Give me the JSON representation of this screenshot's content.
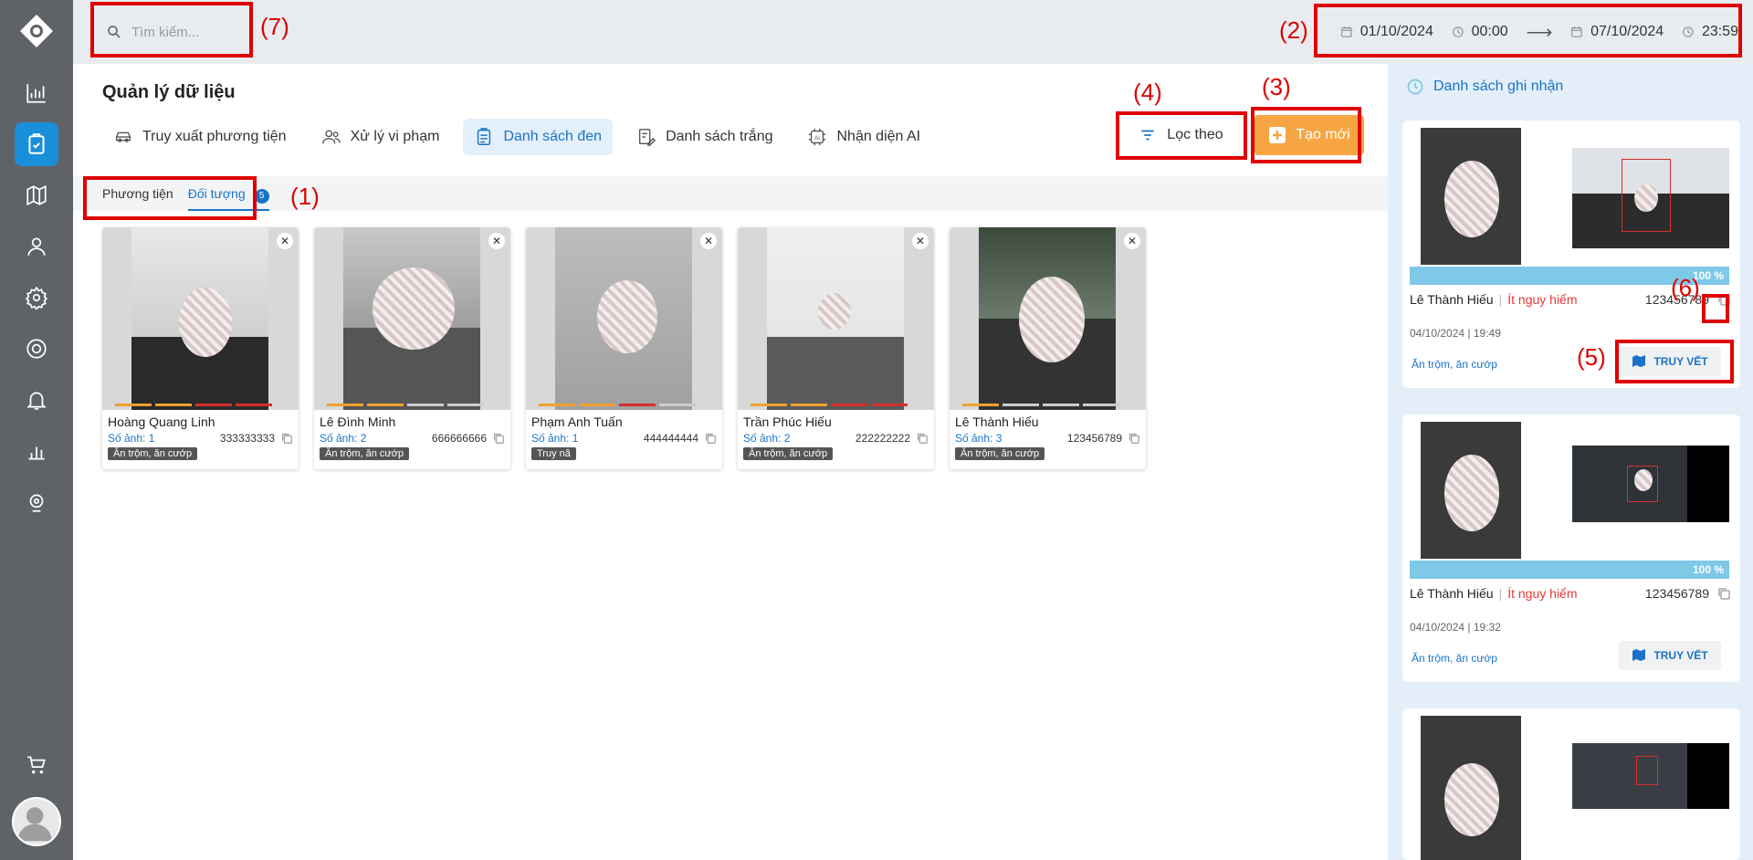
{
  "search": {
    "placeholder": "Tìm kiếm..."
  },
  "date_range": {
    "from_date": "01/10/2024",
    "from_time": "00:00",
    "to_date": "07/10/2024",
    "to_time": "23:59"
  },
  "page": {
    "title": "Quản lý dữ liệu"
  },
  "tabs": [
    {
      "label": "Truy xuất phương tiện",
      "icon": "car-icon"
    },
    {
      "label": "Xử lý vi phạm",
      "icon": "users-icon"
    },
    {
      "label": "Danh sách đen",
      "icon": "clipboard-icon",
      "active": true
    },
    {
      "label": "Danh sách trắng",
      "icon": "edit-list-icon"
    },
    {
      "label": "Nhận diện AI",
      "icon": "ai-chip-icon"
    }
  ],
  "actions": {
    "filter_label": "Lọc theo",
    "new_label": "Tạo mới"
  },
  "subtabs": {
    "vehicle": "Phương tiện",
    "subject": "Đối tượng",
    "subject_count": "5"
  },
  "annotations": [
    "(1)",
    "(2)",
    "(3)",
    "(4)",
    "(5)",
    "(6)",
    "(7)"
  ],
  "cards": [
    {
      "name": "Hoàng Quang Linh",
      "count": "Số ảnh: 1",
      "id": "333333333",
      "tag": "Ăn trộm, ăn cướp",
      "bars": [
        "#f0a030",
        "#f0a030",
        "#d32f2f",
        "#d32f2f"
      ]
    },
    {
      "name": "Lê Đình Minh",
      "count": "Số ảnh: 2",
      "id": "666666666",
      "tag": "Ăn trộm, ăn cướp",
      "bars": [
        "#f0a030",
        "#f0a030",
        "#cccccc",
        "#cccccc"
      ]
    },
    {
      "name": "Phạm Anh Tuấn",
      "count": "Số ảnh: 1",
      "id": "444444444",
      "tag": "Truy nã",
      "bars": [
        "#f0a030",
        "#f0a030",
        "#d32f2f",
        "#cccccc"
      ]
    },
    {
      "name": "Trần Phúc Hiếu",
      "count": "Số ảnh: 2",
      "id": "222222222",
      "tag": "Ăn trộm, ăn cướp",
      "bars": [
        "#f0a030",
        "#f0a030",
        "#d32f2f",
        "#d32f2f"
      ]
    },
    {
      "name": "Lê Thành Hiếu",
      "count": "Số ảnh: 3",
      "id": "123456789",
      "tag": "Ăn trộm, ăn cướp",
      "bars": [
        "#f0a030",
        "#cccccc",
        "#cccccc",
        "#cccccc"
      ]
    }
  ],
  "record_panel": {
    "title": "Danh sách ghi nhận"
  },
  "records": [
    {
      "name": "Lê Thành Hiếu",
      "level": "Ít nguy hiểm",
      "id": "123456789",
      "percent": "100 %",
      "time": "04/10/2024 | 19:49",
      "crime": "Ăn trộm, ăn cướp",
      "trace": "TRUY VẾT"
    },
    {
      "name": "Lê Thành Hiếu",
      "level": "Ít nguy hiểm",
      "id": "123456789",
      "percent": "100 %",
      "time": "04/10/2024 | 19:32",
      "crime": "Ăn trộm, ăn cướp",
      "trace": "TRUY VẾT"
    },
    {
      "name": "",
      "level": "",
      "id": "",
      "percent": "",
      "time": "",
      "crime": "",
      "trace": ""
    }
  ],
  "colors": {
    "accent": "#1a73c8",
    "sidebar": "#5f6368",
    "active_sidebar": "#1a8fd9",
    "new_button": "#f7a542",
    "annotation": "#e00000",
    "danger": "#e53935"
  }
}
